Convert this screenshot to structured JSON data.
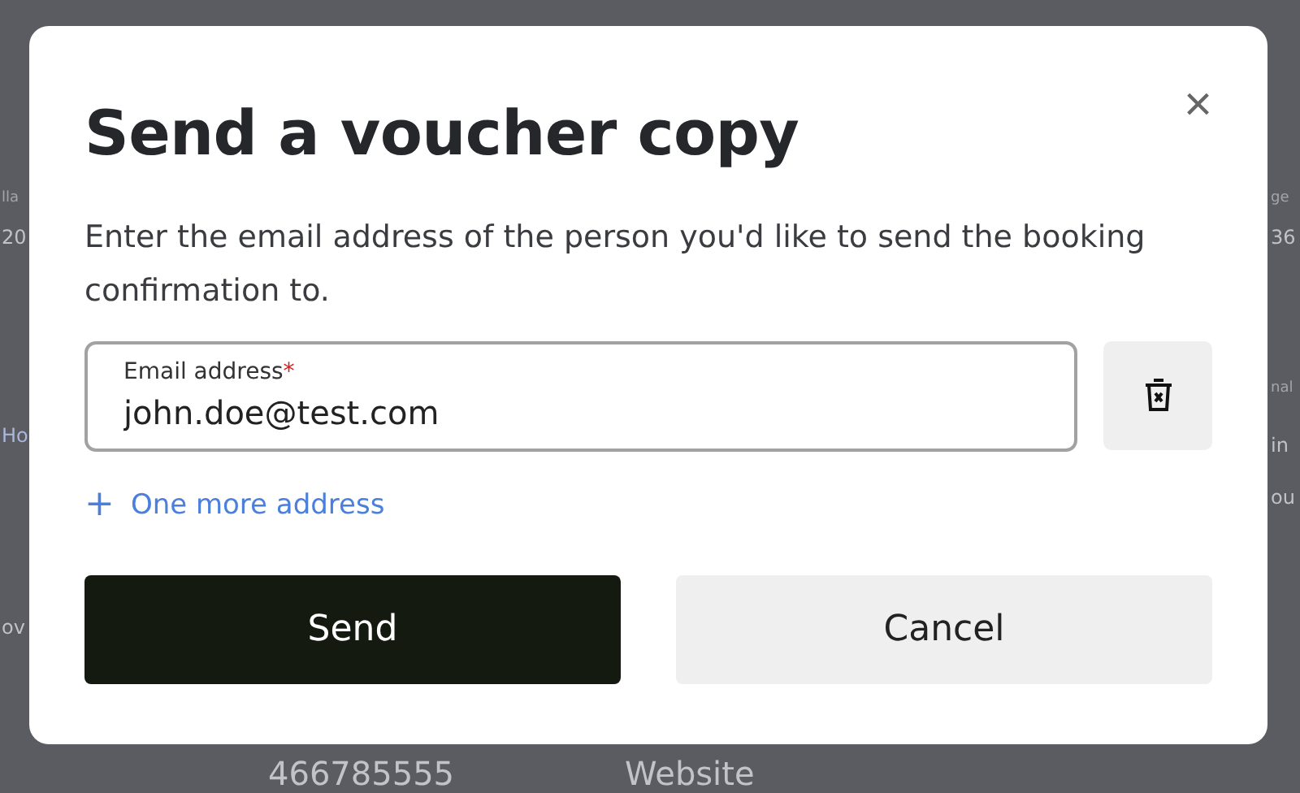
{
  "background": {
    "left_fragments": [
      {
        "text": "lla",
        "kind": "label"
      },
      {
        "text": "20",
        "kind": "value"
      },
      {
        "text": "Ho",
        "kind": "link"
      },
      {
        "text": "ov",
        "kind": "value"
      }
    ],
    "right_fragments": [
      {
        "text": "ge",
        "kind": "label"
      },
      {
        "text": "36",
        "kind": "value"
      },
      {
        "text": "nal",
        "kind": "label"
      },
      {
        "text": "in",
        "kind": "value"
      },
      {
        "text": "ou",
        "kind": "value"
      }
    ],
    "bottom_values": [
      "466785555",
      "Website"
    ]
  },
  "dialog": {
    "title": "Send a voucher copy",
    "close": "×",
    "description": "Enter the email address of the person you'd like to send the booking confirmation to.",
    "email_field": {
      "label": "Email address",
      "required_mark": "*",
      "value": "john.doe@test.com"
    },
    "add_link": {
      "icon": "+",
      "label": "One more address"
    },
    "buttons": [
      {
        "label": "Send",
        "kind": "primary"
      },
      {
        "label": "Cancel",
        "kind": "secondary"
      }
    ]
  }
}
